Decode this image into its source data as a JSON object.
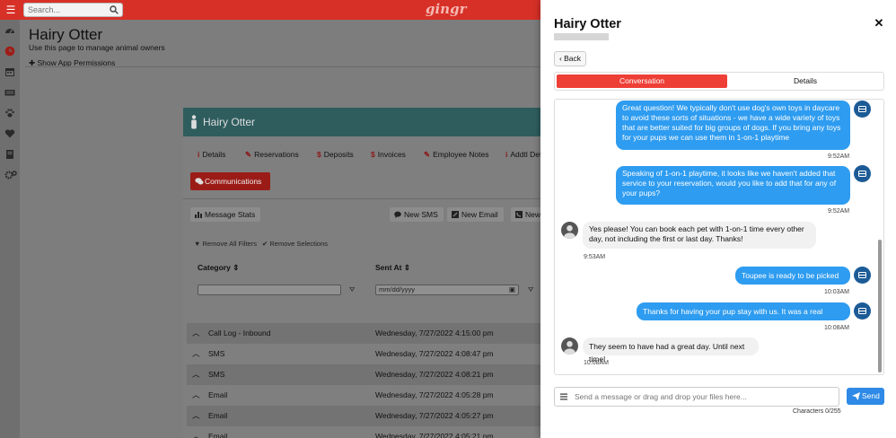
{
  "topbar": {
    "search_placeholder": "Search...",
    "logo": "gingr",
    "menu_icon": "hamburger-icon",
    "search_icon": "search-icon"
  },
  "rail": {
    "icons": [
      "dashboard-icon",
      "clock-icon",
      "calendar-icon",
      "keyboard-icon",
      "paw-icon",
      "heart-icon",
      "book-icon",
      "settings-icon"
    ]
  },
  "page": {
    "title": "Hairy Otter",
    "subtitle": "Use this page to manage animal owners",
    "permissions": "Show App Permissions"
  },
  "card": {
    "owner_name": "Hairy Otter",
    "tabs": [
      {
        "icon": "i",
        "label": "Details"
      },
      {
        "icon": "✎",
        "label": "Reservations"
      },
      {
        "icon": "$",
        "label": "Deposits"
      },
      {
        "icon": "$",
        "label": "Invoices"
      },
      {
        "icon": "✎",
        "label": "Employee Notes"
      },
      {
        "icon": "i",
        "label": "Addtl Deta"
      }
    ],
    "communications_label": "Communications",
    "message_stats_label": "Message Stats",
    "new_sms_label": "New SMS",
    "new_email_label": "New Email",
    "new_call_label": "New Call F",
    "remove_filters_label": "Remove All Filters",
    "remove_selections_label": "Remove Selections",
    "col_category": "Category",
    "col_sent_at": "Sent At",
    "date_placeholder": "mm/dd/yyyy",
    "rows": [
      {
        "category": "Call Log - Inbound",
        "sent_at": "Wednesday, 7/27/2022 4:15:00 pm"
      },
      {
        "category": "SMS",
        "sent_at": "Wednesday, 7/27/2022 4:08:47 pm"
      },
      {
        "category": "SMS",
        "sent_at": "Wednesday, 7/27/2022 4:08:21 pm"
      },
      {
        "category": "Email",
        "sent_at": "Wednesday, 7/27/2022 4:05:28 pm"
      },
      {
        "category": "Email",
        "sent_at": "Wednesday, 7/27/2022 4:05:27 pm"
      },
      {
        "category": "Email",
        "sent_at": "Wednesday, 7/27/2022 4:05:21 pm"
      }
    ]
  },
  "drawer": {
    "title": "Hairy Otter",
    "back_label": "Back",
    "tab_conversation": "Conversation",
    "tab_details": "Details",
    "messages": [
      {
        "dir": "out",
        "text": "Great question! We typically don't use dog's own toys in daycare to avoid these sorts of situations - we have a wide variety of toys that are better suited for big groups of dogs. If you bring any toys for your pups we can use them in 1-on-1 playtime",
        "time": "9:52AM"
      },
      {
        "dir": "out",
        "text": "Speaking of 1-on-1 playtime, it looks like we haven't added that service to your reservation, would you like to add that for any of your pups?",
        "time": "9:52AM"
      },
      {
        "dir": "in",
        "text": "Yes please! You can book each pet with 1-on-1 time every other day, not including the first or last day. Thanks!",
        "time": "9:53AM"
      },
      {
        "dir": "out",
        "text": "Toupee is ready to be picked up!",
        "time": "10:03AM"
      },
      {
        "dir": "out",
        "text": "Thanks for having your pup stay with us. It was a real pleasure!",
        "time": "10:08AM"
      },
      {
        "dir": "in",
        "text": "They seem to have had a great day. Until next time!",
        "time": "10:08AM"
      }
    ],
    "composer_placeholder": "Send a message or drag and drop your files here...",
    "send_label": "Send",
    "char_count": "Characters 0/255"
  },
  "colors": {
    "brand_red": "#d73027",
    "active_tab": "#ee3f36",
    "bubble_blue": "#2e9cf0",
    "send_blue": "#2e8ae6",
    "card_header": "#2f5d5e"
  }
}
